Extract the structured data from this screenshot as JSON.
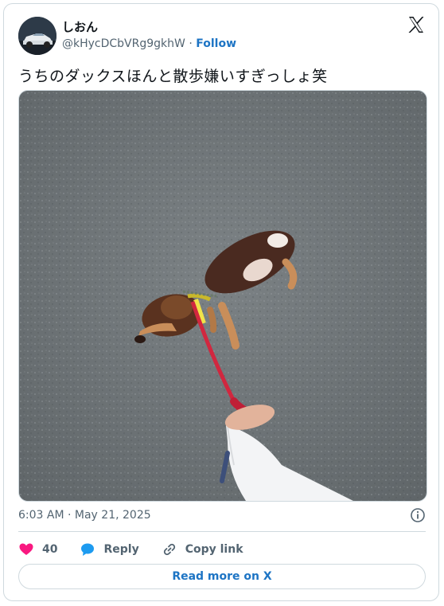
{
  "author": {
    "display_name": "しおん",
    "handle": "@kHycDCbVRg9gkhW",
    "separator": "·",
    "follow_label": "Follow"
  },
  "tweet": {
    "text": "うちのダックスほんと散歩嫌いすぎっしょ笑",
    "timestamp": "6:03 AM · May 21, 2025"
  },
  "actions": {
    "like_count": "40",
    "reply_label": "Reply",
    "copy_link_label": "Copy link"
  },
  "read_more_label": "Read more on X",
  "colors": {
    "like": "#f91880",
    "reply": "#1d9bf0",
    "link_blue": "#1d74c4",
    "muted": "#536471",
    "leash": "#d1273f"
  },
  "icons": [
    "x-logo-icon",
    "info-icon",
    "heart-icon",
    "reply-bubble-icon",
    "link-icon"
  ]
}
